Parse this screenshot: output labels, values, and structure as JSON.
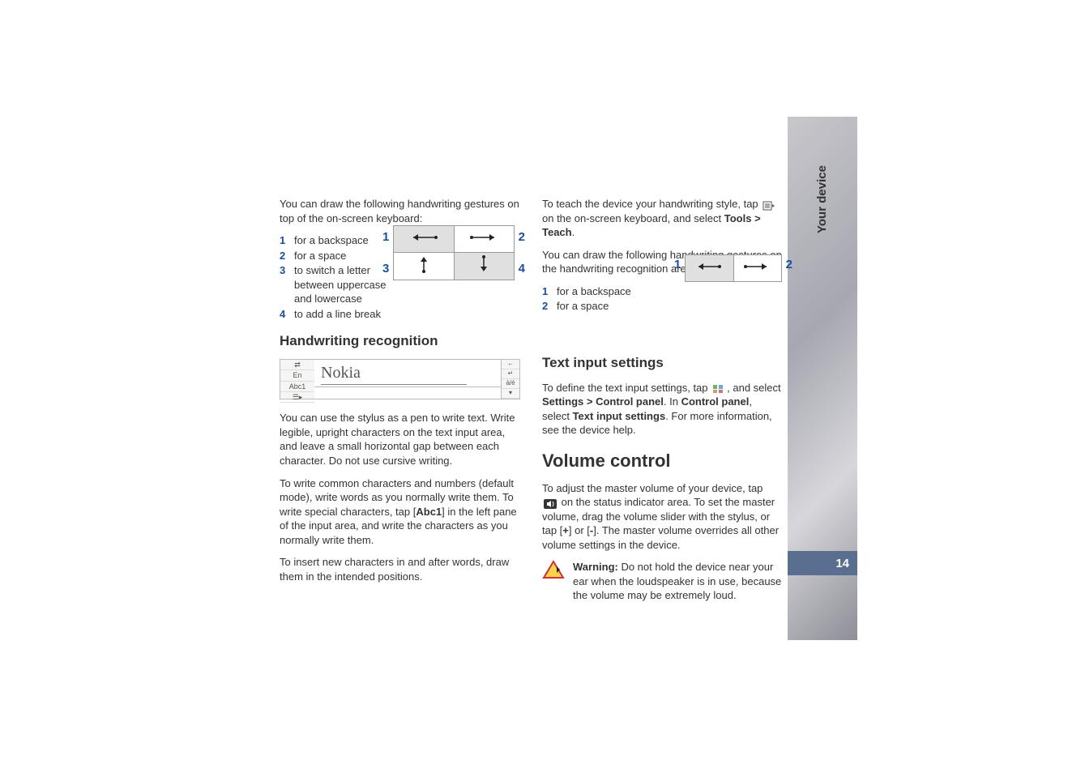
{
  "side": {
    "section_title": "Your device",
    "page_number": "14"
  },
  "left": {
    "intro": "You can draw the following handwriting gestures on top of the on-screen keyboard:",
    "list": [
      {
        "n": "1",
        "text": "for a backspace"
      },
      {
        "n": "2",
        "text": "for a space"
      },
      {
        "n": "3",
        "text": "to switch a letter between uppercase and lowercase"
      },
      {
        "n": "4",
        "text": "to add a line break"
      }
    ],
    "grid_labels": {
      "tl": "1",
      "tr": "2",
      "bl": "3",
      "br": "4"
    },
    "h2": "Handwriting recognition",
    "hw_panel": {
      "left_buttons": [
        "⇄",
        "En",
        "Abc1",
        "☰▸"
      ],
      "right_buttons": [
        "←",
        "↵",
        "à/é",
        "▾"
      ],
      "written_text": "Nokia"
    },
    "p1": "You can use the stylus as a pen to write text. Write legible, upright characters on the text input area, and leave a small horizontal gap between each character. Do not use cursive writing.",
    "p2_a": "To write common characters and numbers (default mode), write words as you normally write them. To write special characters, tap [",
    "p2_bold": "Abc1",
    "p2_b": "] in the left pane of the input area, and write the characters as you normally write them.",
    "p3": "To insert new characters in and after words, draw them in the intended positions."
  },
  "right": {
    "p1_a": "To teach the device your handwriting style, tap ",
    "p1_b": " on the on-screen keyboard, and select ",
    "p1_menu": "Tools > Teach",
    "p1_c": ".",
    "p2": "You can draw the following handwriting gestures on the handwriting recognition area:",
    "list": [
      {
        "n": "1",
        "text": "for a backspace"
      },
      {
        "n": "2",
        "text": "for a space"
      }
    ],
    "grid_labels": {
      "l": "1",
      "r": "2"
    },
    "h2a": "Text input settings",
    "p3_a": "To define the text input settings, tap ",
    "p3_b": ", and select ",
    "p3_menu1": "Settings > Control panel",
    "p3_c": ". In ",
    "p3_menu2": "Control panel",
    "p3_d": ", select ",
    "p3_menu3": "Text input settings",
    "p3_e": ". For more information, see the device help.",
    "h1": "Volume control",
    "p4_a": "To adjust the master volume of your device, tap ",
    "p4_b": " on the status indicator area. To set the master volume, drag the volume slider with the stylus, or tap [",
    "p4_plus": "+",
    "p4_c": "] or [",
    "p4_minus": "-",
    "p4_d": "]. The master volume overrides all other volume settings in the device.",
    "warning_label": "Warning: ",
    "warning_text": "Do not hold the device near your ear when the loudspeaker is in use, because the volume may be extremely loud."
  }
}
